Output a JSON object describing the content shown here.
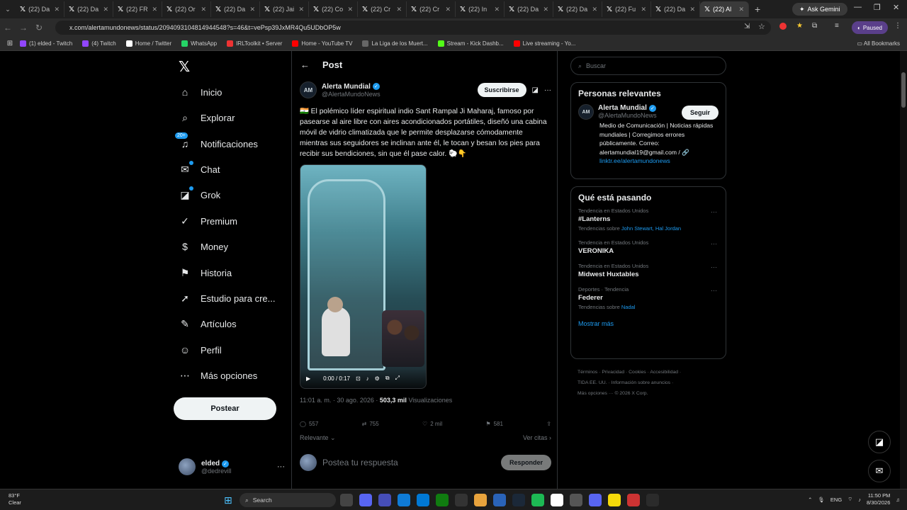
{
  "browser": {
    "tabs": [
      {
        "label": "(22) Da"
      },
      {
        "label": "(22) Da"
      },
      {
        "label": "(22) FR"
      },
      {
        "label": "(22) Or"
      },
      {
        "label": "(22) Da"
      },
      {
        "label": "(22) Jai"
      },
      {
        "label": "(22) Co"
      },
      {
        "label": "(22) Cr"
      },
      {
        "label": "(22) Cr"
      },
      {
        "label": "(22) In"
      },
      {
        "label": "(22) Da"
      },
      {
        "label": "(22) Da"
      },
      {
        "label": "(22) Fu"
      },
      {
        "label": "(22) Da"
      },
      {
        "label": "(22) Al"
      }
    ],
    "ask_gemini": "Ask Gemini",
    "url": "x.com/alertamundonews/status/2094093104814944548?s=46&t=vePsp39JxMR4Qu5UDbOP5w",
    "paused": "Paused",
    "bookmarks": [
      {
        "label": "(1) elded - Twitch",
        "color": "#9146ff"
      },
      {
        "label": "(4) Twitch",
        "color": "#9146ff"
      },
      {
        "label": "Home / Twitter",
        "color": "#ffffff"
      },
      {
        "label": "WhatsApp",
        "color": "#25d366"
      },
      {
        "label": "IRLToolkit • Server",
        "color": "#e33"
      },
      {
        "label": "Home - YouTube TV",
        "color": "#ff0000"
      },
      {
        "label": "La Liga de los Muert...",
        "color": "#666"
      },
      {
        "label": "Stream - Kick Dashb...",
        "color": "#53fc18"
      },
      {
        "label": "Live streaming - Yo...",
        "color": "#ff0000"
      }
    ],
    "all_bookmarks": "All Bookmarks"
  },
  "nav": {
    "items": [
      {
        "label": "Inicio",
        "icon": "home-icon",
        "glyph": "⌂"
      },
      {
        "label": "Explorar",
        "icon": "search-icon",
        "glyph": "⌕"
      },
      {
        "label": "Notificaciones",
        "icon": "bell-icon",
        "glyph": "♫",
        "badge": "20+"
      },
      {
        "label": "Chat",
        "icon": "chat-icon",
        "glyph": "✉",
        "dot": true
      },
      {
        "label": "Grok",
        "icon": "grok-icon",
        "glyph": "◪",
        "dot": true
      },
      {
        "label": "Premium",
        "icon": "premium-icon",
        "glyph": "✓"
      },
      {
        "label": "Money",
        "icon": "money-icon",
        "glyph": "$"
      },
      {
        "label": "Historia",
        "icon": "bookmark-icon",
        "glyph": "⚑"
      },
      {
        "label": "Estudio para cre...",
        "icon": "rocket-icon",
        "glyph": "➚"
      },
      {
        "label": "Artículos",
        "icon": "article-icon",
        "glyph": "✎"
      },
      {
        "label": "Perfil",
        "icon": "profile-icon",
        "glyph": "☺"
      },
      {
        "label": "Más opciones",
        "icon": "more-options-icon",
        "glyph": "⋯"
      }
    ],
    "post_button": "Postear",
    "user_name": "elded",
    "user_handle": "@dedrevill"
  },
  "post": {
    "header": "Post",
    "author_name": "Alerta Mundial",
    "author_handle": "@AlertaMundoNews",
    "subscribe": "Suscribirse",
    "text": "🇮🇳 El polémico líder espiritual indio Sant Rampal Ji Maharaj, famoso por pasearse al aire libre con aires acondicionados portátiles, diseñó una cabina móvil de vidrio climatizada que le permite desplazarse cómodamente mientras sus seguidores se inclinan ante él, le tocan y besan los pies para recibir sus bendiciones, sin que él pase calor. 🐑👇",
    "video_time": "0:00 / 0:17",
    "timestamp": "11:01 a. m. · 30 ago. 2026 · ",
    "views_count": "503,3 mil",
    "views_label": " Visualizaciones",
    "replies": "557",
    "reposts": "755",
    "likes": "2 mil",
    "bookmarks": "581",
    "relevance": "Relevante",
    "quotes": "Ver citas",
    "reply_placeholder": "Postea tu respuesta",
    "reply_button": "Responder"
  },
  "sidebar": {
    "search_placeholder": "Buscar",
    "relevant_title": "Personas relevantes",
    "rel_name": "Alerta Mundial",
    "rel_handle": "@AlertaMundoNews",
    "follow": "Seguir",
    "rel_bio": "Medio de Comunicación | Noticias rápidas mundiales | Corregimos errores públicamente. Correo: alertamundial19@gmail.com / 🔗",
    "rel_link": "linktr.ee/alertamundonews",
    "trending_title": "Qué está pasando",
    "trends": [
      {
        "context": "Tendencia en Estados Unidos",
        "name": "#Lanterns",
        "sub_prefix": "Tendencias sobre ",
        "sub_topics": "John Stewart, Hal Jordan"
      },
      {
        "context": "Tendencia en Estados Unidos",
        "name": "VERONIKA",
        "sub_prefix": "",
        "sub_topics": ""
      },
      {
        "context": "Tendencia en Estados Unidos",
        "name": "Midwest Huxtables",
        "sub_prefix": "",
        "sub_topics": ""
      },
      {
        "context": "Deportes · Tendencia",
        "name": "Federer",
        "sub_prefix": "Tendencias sobre ",
        "sub_topics": "Nadal"
      }
    ],
    "show_more": "Mostrar más",
    "footer1": "Términos · Privacidad · Cookies · Accesibilidad ·",
    "footer2": "TIDA EE. UU. · Información sobre anuncios ·",
    "footer3": "Más opciones ··· © 2026 X Corp."
  },
  "taskbar": {
    "temp": "83°F",
    "condition": "Clear",
    "search": "Search",
    "lang": "ENG",
    "time": "11:50 PM",
    "date": "8/30/2026"
  }
}
